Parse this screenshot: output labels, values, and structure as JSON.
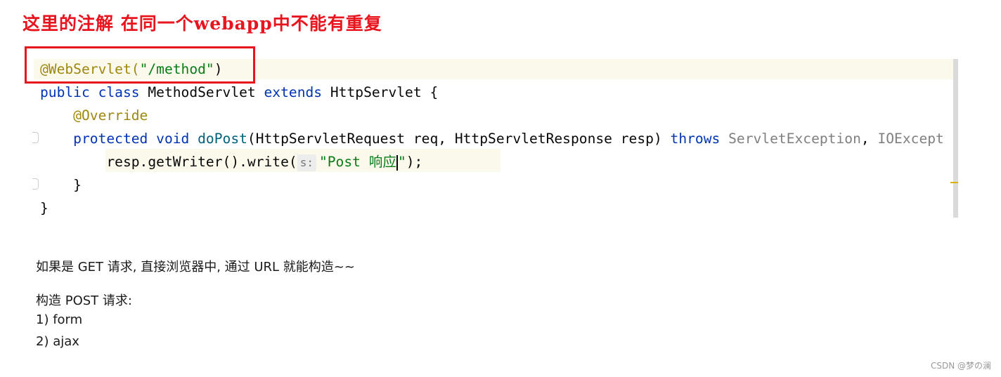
{
  "heading": "这里的注解 在同一个webapp中不能有重复",
  "code": {
    "lines": [
      [
        {
          "t": "@WebServlet(",
          "k": "ann"
        },
        {
          "t": "\"/method\"",
          "k": "str"
        },
        {
          "t": ")",
          "k": "plain"
        }
      ],
      [
        {
          "t": "public class ",
          "k": "kw"
        },
        {
          "t": "MethodServlet ",
          "k": "plain"
        },
        {
          "t": "extends ",
          "k": "kw"
        },
        {
          "t": "HttpServlet {",
          "k": "plain"
        }
      ],
      [
        {
          "t": "    @Override",
          "k": "ann"
        }
      ],
      [
        {
          "t": "    protected void ",
          "k": "kw"
        },
        {
          "t": "doPost",
          "k": "fn"
        },
        {
          "t": "(HttpServletRequest req, HttpServletResponse resp) ",
          "k": "plain"
        },
        {
          "t": "throws ",
          "k": "kw"
        },
        {
          "t": "ServletException",
          "k": "exc"
        },
        {
          "t": ", ",
          "k": "plain"
        },
        {
          "t": "IOExcept",
          "k": "exc"
        }
      ],
      [
        {
          "t": "        resp.getWriter().write(",
          "k": "plain"
        },
        {
          "t": "s:",
          "k": "hint"
        },
        {
          "t": "\"Post 响应",
          "k": "str"
        },
        {
          "t": "",
          "k": "caret"
        },
        {
          "t": "\"",
          "k": "str"
        },
        {
          "t": ");",
          "k": "plain"
        }
      ],
      [
        {
          "t": "    }",
          "k": "plain"
        }
      ],
      [
        {
          "t": "}",
          "k": "plain"
        }
      ]
    ]
  },
  "notes": [
    "如果是 GET 请求, 直接浏览器中, 通过 URL 就能构造~~",
    "构造 POST 请求:",
    "1) form",
    "2) ajax"
  ],
  "watermark": "CSDN @梦の澜",
  "colors": {
    "highlight_box": "#e8141e",
    "heading": "#e8141e",
    "keyword": "#0033b3",
    "annotation": "#9e880d",
    "string": "#067d17"
  }
}
